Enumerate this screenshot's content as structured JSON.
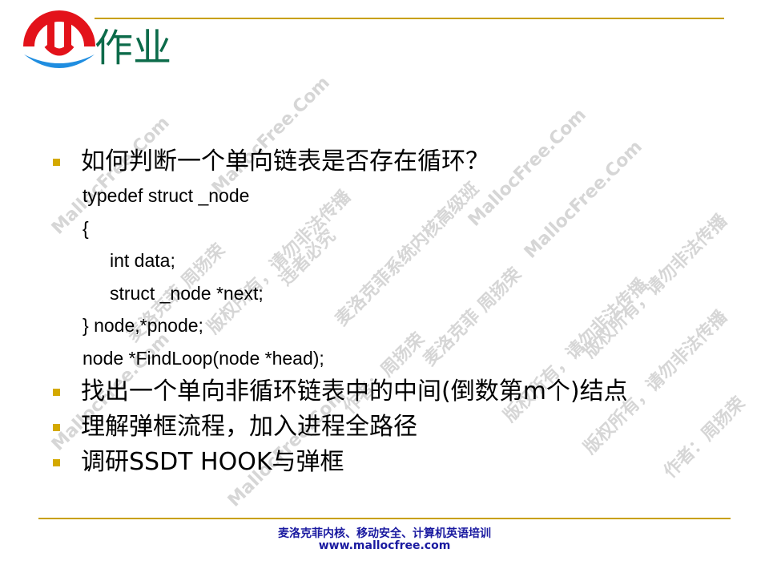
{
  "header": {
    "title": "作业"
  },
  "colors": {
    "title": "#0c6b4a",
    "rule": "#c8a000",
    "bullet": "#d4a900",
    "footer": "#1a1aa0",
    "logo_red": "#e3121a",
    "logo_blue": "#1f8de0"
  },
  "logo": {
    "icon": "mallocfree-logo-icon"
  },
  "bullets": [
    {
      "text": "如何判断一个单向链表是否存在循环？"
    },
    {
      "text": "找出一个单向非循环链表中的中间(倒数第m个)结点"
    },
    {
      "text": "理解弹框流程，加入进程全路径"
    },
    {
      "text": "调研SSDT HOOK与弹框"
    }
  ],
  "code_lines": [
    "typedef struct _node",
    "{",
    "int data;",
    "struct _node *next;",
    "} node,*pnode;",
    "node *FindLoop(node *head);"
  ],
  "watermarks": [
    "MallocFree.Com",
    "麦洛克菲 周扬荣",
    "版权所有，请勿非法传播",
    "作者：周扬荣",
    "麦洛克菲系统内核高级班",
    "违者必究"
  ],
  "footer": {
    "line1": "麦洛克菲内核、移动安全、计算机英语培训",
    "line2": "www.mallocfree.com"
  }
}
